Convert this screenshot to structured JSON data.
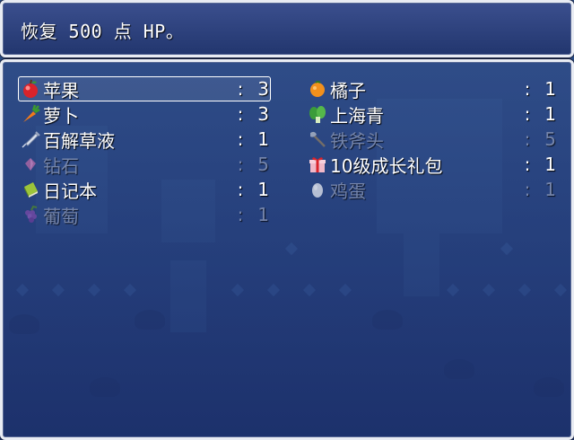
{
  "help": {
    "text": "恢复 500 点 HP。"
  },
  "inventory": {
    "separator": ":",
    "items": [
      {
        "name": "苹果",
        "count": "3",
        "icon": "apple-icon",
        "enabled": true,
        "selected": true
      },
      {
        "name": "橘子",
        "count": "1",
        "icon": "orange-icon",
        "enabled": true
      },
      {
        "name": "萝卜",
        "count": "3",
        "icon": "carrot-icon",
        "enabled": true
      },
      {
        "name": "上海青",
        "count": "1",
        "icon": "greens-icon",
        "enabled": true
      },
      {
        "name": "百解草液",
        "count": "1",
        "icon": "syringe-icon",
        "enabled": true
      },
      {
        "name": "铁斧头",
        "count": "5",
        "icon": "axe-icon",
        "enabled": false
      },
      {
        "name": "钻石",
        "count": "5",
        "icon": "gem-icon",
        "enabled": false
      },
      {
        "name": "10级成长礼包",
        "count": "1",
        "icon": "gift-icon",
        "enabled": true
      },
      {
        "name": "日记本",
        "count": "1",
        "icon": "book-icon",
        "enabled": true
      },
      {
        "name": "鸡蛋",
        "count": "1",
        "icon": "egg-icon",
        "enabled": false
      },
      {
        "name": "葡萄",
        "count": "1",
        "icon": "grape-icon",
        "enabled": false
      }
    ]
  }
}
